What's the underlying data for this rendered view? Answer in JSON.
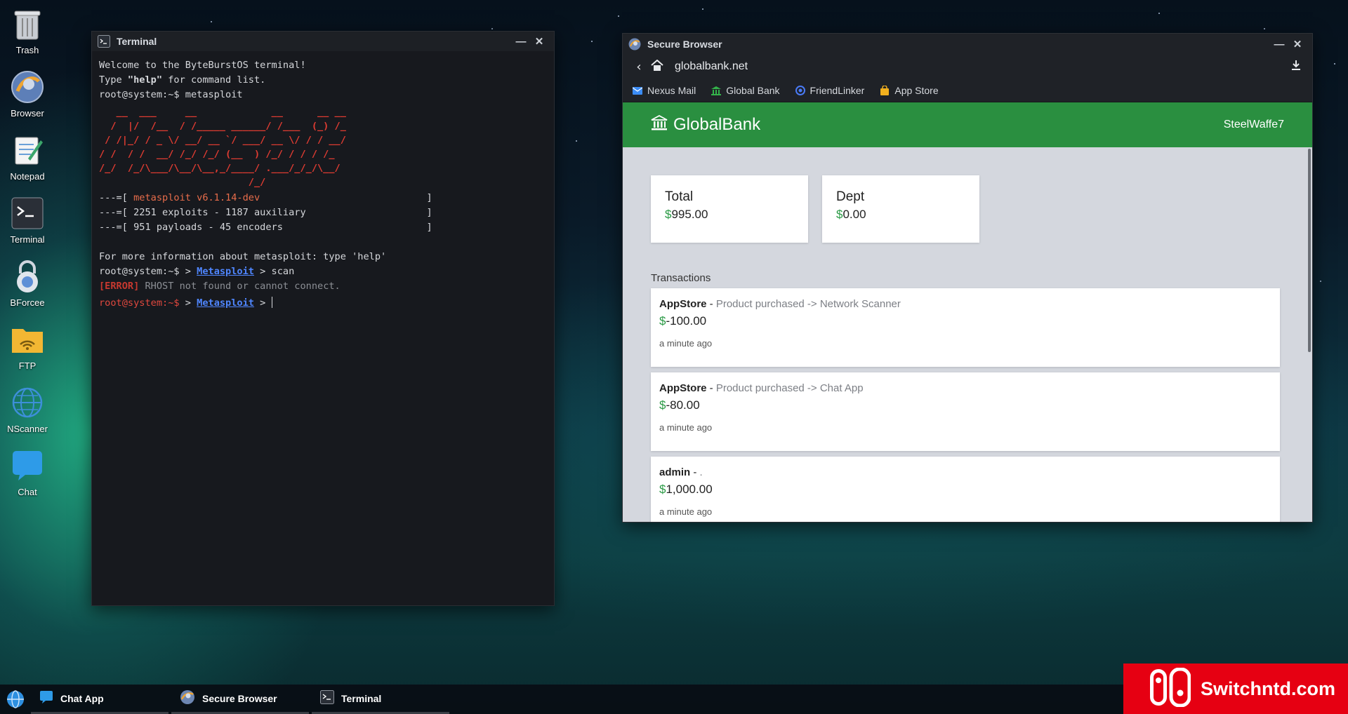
{
  "desktop": {
    "icons": [
      {
        "label": "Trash",
        "icon": "trash-icon"
      },
      {
        "label": "Browser",
        "icon": "browser-globe-icon"
      },
      {
        "label": "Notepad",
        "icon": "notepad-icon"
      },
      {
        "label": "Terminal",
        "icon": "terminal-icon"
      },
      {
        "label": "BForcee",
        "icon": "lock-icon"
      },
      {
        "label": "FTP",
        "icon": "folder-wifi-icon"
      },
      {
        "label": "NScanner",
        "icon": "network-globe-icon"
      },
      {
        "label": "Chat",
        "icon": "chat-bubble-icon"
      }
    ]
  },
  "terminal": {
    "title": "Terminal",
    "welcome": "Welcome to the ByteBurstOS terminal!",
    "help_pre": "Type ",
    "help_word": "\"help\"",
    "help_post": " for command list.",
    "cmd1_prompt": "root@system:~$ ",
    "cmd1": "metasploit",
    "ascii_art": "   __  ___     __             __      __ __\n  /  |/  /__  / /_____ ______/ /___  (_) /_\n / /|_/ / _ \\/ __/ __ `/ ___/ __ \\/ / / __/\n/ /  / /  __/ /_/ /_/ (__  ) /_/ / / / /_\n/_/  /_/\\___/\\__/\\__,_/____/ .___/_/_/\\__/\n                          /_/",
    "banner_lines": [
      {
        "prefix": "---=[ ",
        "text": "metasploit v6.1.14-dev",
        "suffix": "                             ]"
      },
      {
        "prefix": "---=[ ",
        "text": "2251 exploits - 1187 auxiliary",
        "suffix": "                     ]"
      },
      {
        "prefix": "---=[ ",
        "text": "951 payloads - 45 encoders",
        "suffix": "                         ]"
      }
    ],
    "more_info": "For more information about metasploit: type 'help'",
    "prompt": "root@system:~$",
    "module": "Metasploit",
    "cmd2": "scan",
    "error_tag": "[ERROR]",
    "error_msg": " RHOST not found or cannot connect."
  },
  "browser": {
    "title": "Secure Browser",
    "url": "globalbank.net",
    "bookmarks": [
      {
        "label": "Nexus Mail",
        "icon": "mail-icon",
        "color": "#3b8cf5"
      },
      {
        "label": "Global Bank",
        "icon": "bank-icon",
        "color": "#34b34a"
      },
      {
        "label": "FriendLinker",
        "icon": "friendlinker-icon",
        "color": "#4a7bf7"
      },
      {
        "label": "App Store",
        "icon": "shopping-bag-icon",
        "color": "#f2b01e"
      }
    ],
    "bank": {
      "name": "GlobalBank",
      "user": "SteelWaffe7",
      "currency": "$",
      "accent": "#2a8f40",
      "total_label": "Total",
      "total": "995.00",
      "dept_label": "Dept",
      "dept": "0.00",
      "transactions_title": "Transactions",
      "transactions": [
        {
          "from": "AppStore",
          "sep": " - ",
          "desc": "Product purchased -> Network Scanner",
          "amount": "-100.00",
          "time": "a minute ago"
        },
        {
          "from": "AppStore",
          "sep": " - ",
          "desc": "Product purchased -> Chat App",
          "amount": "-80.00",
          "time": "a minute ago"
        },
        {
          "from": "admin",
          "sep": " - ",
          "desc": ".",
          "amount": "1,000.00",
          "time": "a minute ago"
        }
      ]
    }
  },
  "taskbar": {
    "items": [
      {
        "label": "Chat App",
        "icon": "chat-bubble-icon"
      },
      {
        "label": "Secure Browser",
        "icon": "browser-globe-icon"
      },
      {
        "label": "Terminal",
        "icon": "terminal-icon"
      }
    ]
  },
  "watermark": {
    "text": "Switchntd.com"
  }
}
